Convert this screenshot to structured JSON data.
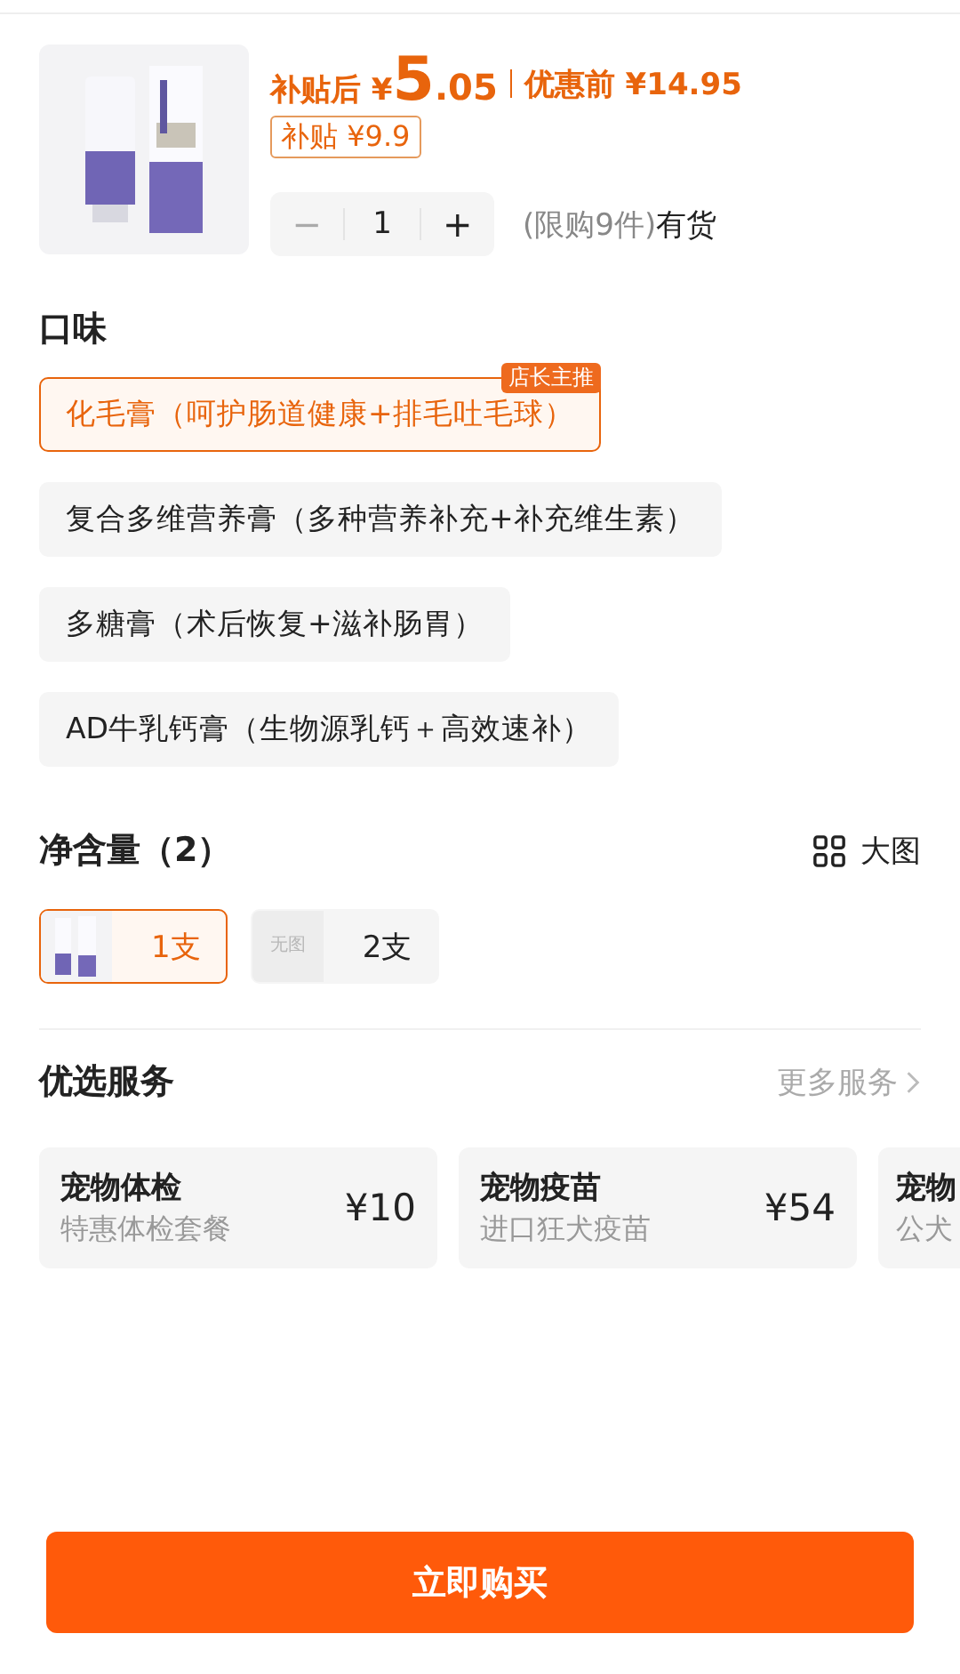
{
  "product": {
    "price_prefix": "补贴后",
    "price_currency": "¥",
    "price_integer": "5",
    "price_decimal": ".05",
    "original_price": "优惠前 ¥14.95",
    "subsidy_badge": "补贴 ¥9.9",
    "quantity": "1",
    "minus": "−",
    "plus": "+",
    "limit": "(限购9件)",
    "stock": "有货"
  },
  "flavor": {
    "title": "口味",
    "options": [
      {
        "label": "化毛膏（呵护肠道健康+排毛吐毛球）",
        "selected": true,
        "badge": "店长主推"
      },
      {
        "label": "复合多维营养膏（多种营养补充+补充维生素）",
        "selected": false
      },
      {
        "label": "多糖膏（术后恢复+滋补肠胃）",
        "selected": false
      },
      {
        "label": "AD牛乳钙膏（生物源乳钙＋高效速补）",
        "selected": false
      }
    ]
  },
  "size": {
    "title": "净含量（2）",
    "view_toggle": "大图",
    "options": [
      {
        "label": "1支",
        "selected": true
      },
      {
        "label": "2支",
        "selected": false,
        "thumb": {
          "kind": "empty",
          "text": "无图"
        }
      }
    ]
  },
  "services": {
    "title": "优选服务",
    "more": "更多服务",
    "cards": [
      {
        "name": "宠物体检",
        "desc": "特惠体检套餐",
        "price": "¥10"
      },
      {
        "name": "宠物疫苗",
        "desc": "进口狂犬疫苗",
        "price": "¥54"
      },
      {
        "name": "宠物",
        "desc": "公犬"
      }
    ]
  },
  "buy_button": "立即购买"
}
